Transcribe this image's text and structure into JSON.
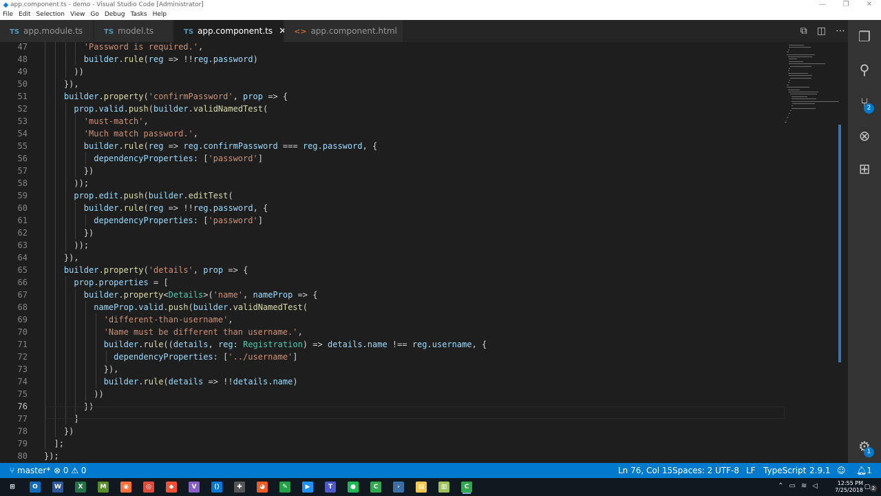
{
  "window": {
    "title": "app.component.ts - demo - Visual Studio Code [Administrator]",
    "controls": [
      "—",
      "❐",
      "✕"
    ]
  },
  "menu": [
    "File",
    "Edit",
    "Selection",
    "View",
    "Go",
    "Debug",
    "Tasks",
    "Help"
  ],
  "tabs": [
    {
      "label": "app.module.ts",
      "lang": "TS"
    },
    {
      "label": "model.ts",
      "lang": "TS"
    },
    {
      "label": "app.component.ts",
      "lang": "TS",
      "active": true
    },
    {
      "label": "app.component.html",
      "lang": "<>"
    }
  ],
  "editor_actions": [
    "open-preview-icon",
    "split-editor-icon",
    "more-actions-icon"
  ],
  "editor": {
    "current_line": 76,
    "lines": [
      {
        "n": "47",
        "text": "        'Password is required.',"
      },
      {
        "n": "48",
        "text": "        builder.rule(reg => !!reg.password)"
      },
      {
        "n": "49",
        "text": "      ))"
      },
      {
        "n": "50",
        "text": "    }),"
      },
      {
        "n": "51",
        "text": "    builder.property('confirmPassword', prop => {"
      },
      {
        "n": "52",
        "text": "      prop.valid.push(builder.validNamedTest("
      },
      {
        "n": "53",
        "text": "        'must-match',"
      },
      {
        "n": "54",
        "text": "        'Much match password.',"
      },
      {
        "n": "55",
        "text": "        builder.rule(reg => reg.confirmPassword === reg.password, {"
      },
      {
        "n": "56",
        "text": "          dependencyProperties: ['password']"
      },
      {
        "n": "57",
        "text": "        })"
      },
      {
        "n": "58",
        "text": "      ));"
      },
      {
        "n": "59",
        "text": "      prop.edit.push(builder.editTest("
      },
      {
        "n": "60",
        "text": "        builder.rule(reg => !!reg.password, {"
      },
      {
        "n": "61",
        "text": "          dependencyProperties: ['password']"
      },
      {
        "n": "62",
        "text": "        })"
      },
      {
        "n": "63",
        "text": "      ));"
      },
      {
        "n": "64",
        "text": "    }),"
      },
      {
        "n": "65",
        "text": "    builder.property('details', prop => {"
      },
      {
        "n": "66",
        "text": "      prop.properties = ["
      },
      {
        "n": "67",
        "text": "        builder.property<Details>('name', nameProp => {"
      },
      {
        "n": "68",
        "text": "          nameProp.valid.push(builder.validNamedTest("
      },
      {
        "n": "69",
        "text": "            'different-than-username',"
      },
      {
        "n": "70",
        "text": "            'Name must be different than username.',"
      },
      {
        "n": "71",
        "text": "            builder.rule((details, reg: Registration) => details.name !== reg.username, {"
      },
      {
        "n": "72",
        "text": "              dependencyProperties: ['../username']"
      },
      {
        "n": "73",
        "text": "            }),"
      },
      {
        "n": "74",
        "text": "            builder.rule(details => !!details.name)"
      },
      {
        "n": "75",
        "text": "          ))"
      },
      {
        "n": "76",
        "text": "        })"
      },
      {
        "n": "77",
        "text": "      ]"
      },
      {
        "n": "78",
        "text": "    })"
      },
      {
        "n": "79",
        "text": "  ];"
      },
      {
        "n": "80",
        "text": "});"
      }
    ]
  },
  "activity_bar": {
    "items": [
      "explorer-icon",
      "search-icon",
      "source-control-icon",
      "debug-icon",
      "extensions-icon"
    ],
    "scm_badge": "2",
    "settings_badge": "1"
  },
  "statusbar": {
    "branch": "master*",
    "errors": "0",
    "warnings": "0",
    "position": "Ln 76, Col 15",
    "spaces": "Spaces: 2",
    "encoding": "UTF-8",
    "eol": "LF",
    "language": "TypeScript",
    "version": "2.9.1",
    "notifications": "1"
  },
  "taskbar": {
    "time": "12:55 PM",
    "date": "7/25/2018",
    "apps": [
      "windows-start-icon",
      "outlook-icon",
      "word-icon",
      "excel-icon",
      "minecraft-icon",
      "firefox-icon",
      "chrome-icon",
      "git-icon",
      "visual-studio-icon",
      "vscode-icon",
      "tool-icon",
      "postman-icon",
      "app-icon",
      "terminal-app-icon",
      "teams-icon",
      "spotify-icon",
      "camtasia-icon",
      "powershell-icon",
      "file-explorer-icon",
      "notepad-icon",
      "camtasia-recorder-icon"
    ],
    "notification_count": "2"
  },
  "colors": {
    "accent": "#007acc",
    "editor_bg": "#1e1e1e",
    "string": "#ce9178",
    "function": "#dcdcaa",
    "variable": "#9cdcfe",
    "type": "#4ec9b0"
  }
}
